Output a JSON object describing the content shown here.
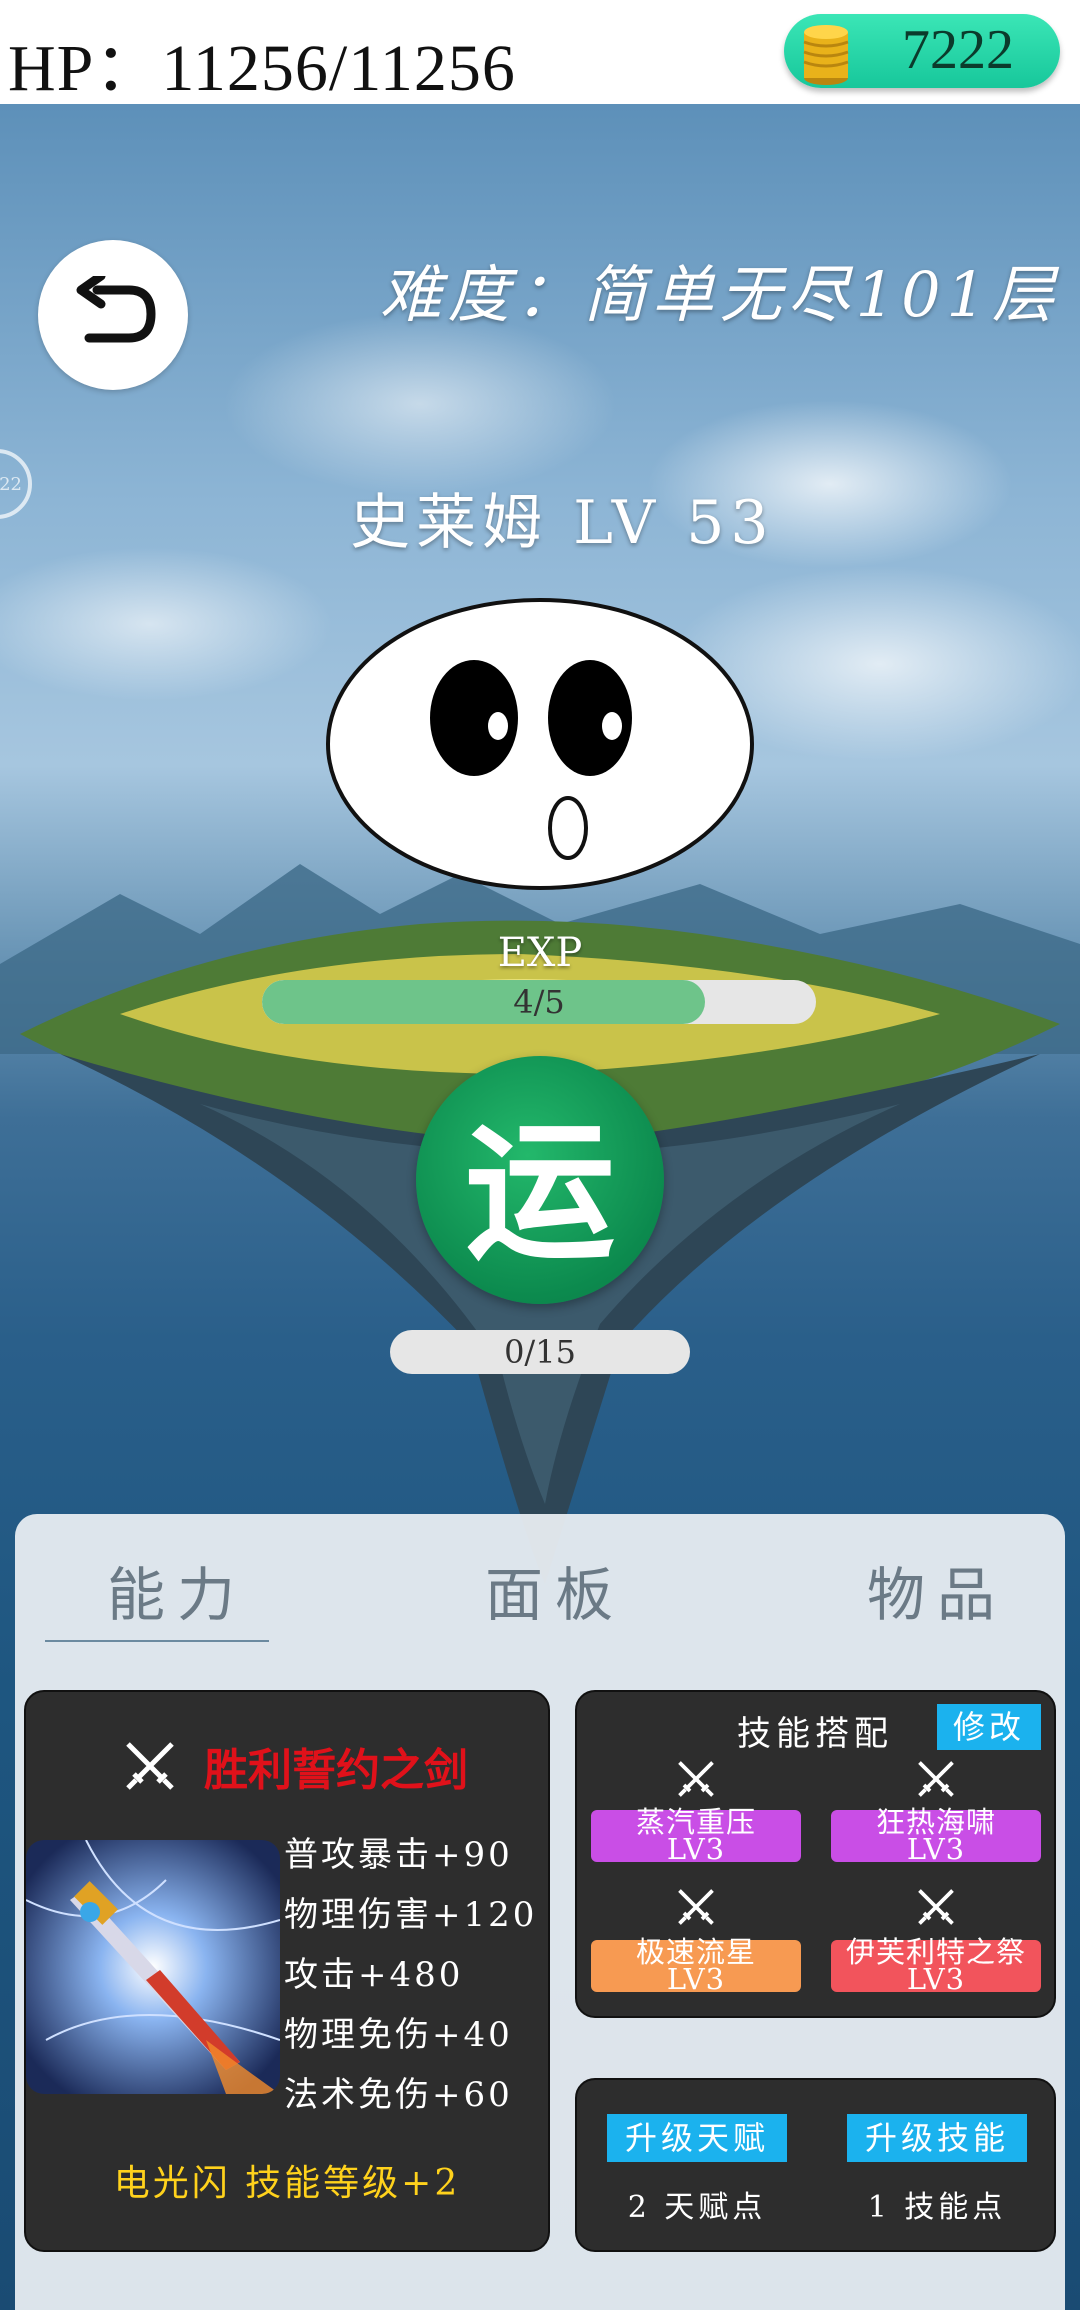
{
  "status_bar": {
    "hp_label": "HP：",
    "hp_value": "11256/11256",
    "coins": "7222",
    "coin_icon": "gold-coin-stack-icon"
  },
  "header": {
    "difficulty": "难度：简单无尽101层",
    "side_ring_text": "22"
  },
  "monster": {
    "name_level": "史莱姆 LV 53",
    "exp_label": "EXP",
    "exp_current": 4,
    "exp_max": 5,
    "exp_text": "4/5",
    "action_button": "运",
    "progress_current": 0,
    "progress_max": 15,
    "progress_text": "0/15"
  },
  "tabs": [
    {
      "label": "能力",
      "active": true
    },
    {
      "label": "面板",
      "active": false
    },
    {
      "label": "物品",
      "active": false
    }
  ],
  "weapon": {
    "name": "胜利誓约之剑",
    "stats": [
      "普攻暴击+90",
      "物理伤害+120",
      "攻击+480",
      "物理免伤+40",
      "法术免伤+60"
    ],
    "skill_bonus": "电光闪 技能等级+2"
  },
  "skill_loadout": {
    "title": "技能搭配",
    "modify_label": "修改",
    "skills": [
      {
        "name": "蒸汽重压",
        "level": "LV3",
        "color": "#c94ee6"
      },
      {
        "name": "狂热海啸",
        "level": "LV3",
        "color": "#c94ee6"
      },
      {
        "name": "极速流星",
        "level": "LV3",
        "color": "#f79a52"
      },
      {
        "name": "伊芙利特之祭",
        "level": "LV3",
        "color": "#f2545c"
      }
    ]
  },
  "upgrades": {
    "talent_button": "升级天赋",
    "talent_points": "2 天赋点",
    "skill_button": "升级技能",
    "skill_points": "1 技能点"
  },
  "colors": {
    "coin_pill": "#21d3a5",
    "exp_fill": "#6ec48a",
    "action_button": "#12a05c",
    "weapon_name": "#e0111a",
    "skill_bonus": "#ffd21c",
    "accent_button": "#1bb2ee"
  }
}
